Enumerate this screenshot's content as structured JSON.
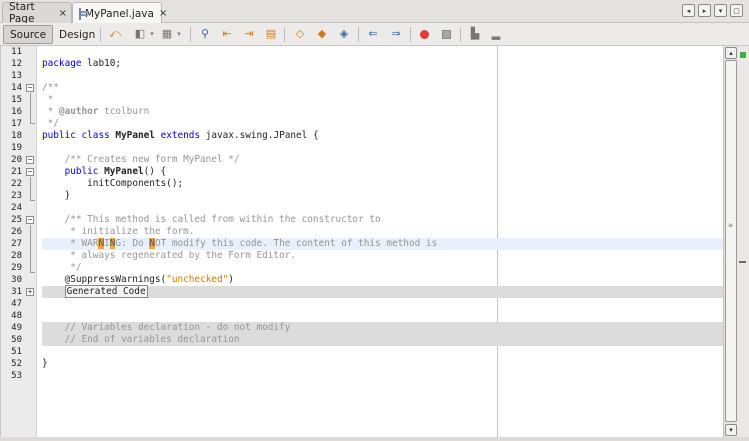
{
  "tabs": [
    {
      "label": "Start Page",
      "active": false
    },
    {
      "label": "MyPanel.java",
      "active": true
    }
  ],
  "tab_close_glyph": "×",
  "window_controls": [
    "◂",
    "▸",
    "▾",
    "▢"
  ],
  "toolbar": {
    "source_label": "Source",
    "design_label": "Design",
    "source_pressed": true
  },
  "gutter": {
    "line_numbers": [
      "11",
      "12",
      "13",
      "14",
      "15",
      "16",
      "17",
      "18",
      "19",
      "20",
      "21",
      "22",
      "23",
      "24",
      "25",
      "26",
      "27",
      "28",
      "29",
      "30",
      "31",
      "47",
      "48",
      "49",
      "50",
      "51",
      "52",
      "53"
    ]
  },
  "code": {
    "l11": "",
    "l12_kw": "package",
    "l12_rest": " lab10;",
    "l13": "",
    "l14": "/**",
    "l15": " *",
    "l16_pre": " * ",
    "l16_tag": "@author",
    "l16_rest": " tcolburn",
    "l17": " */",
    "l18_kw": "public class",
    "l18_cls": "MyPanel",
    "l18_kw2": "extends",
    "l18_rest": " javax.swing.JPanel {",
    "l20": "    /** Creates new form MyPanel */",
    "l21_kw": "public",
    "l21_name": "MyPanel",
    "l21_rest": "() {",
    "l22_a": "        initCo",
    "l22_b": "mponents();",
    "l23": "    }",
    "l25": "    /** This method is called from within the constructor to",
    "l26": "     * initialize the form.",
    "l27_a": "     * WAR",
    "l27_m1": "N",
    "l27_b": "I",
    "l27_m2": "N",
    "l27_c": "G: Do ",
    "l27_m3": "N",
    "l27_d": "OT modify this code. The content of this method is",
    "l28": "     * always regenerated by the Form Editor.",
    "l29": "     */",
    "l30_ann": "    @SuppressWarnings(",
    "l30_str": "\"unchecked\"",
    "l30_rest": ")",
    "l31": "Generated Code",
    "l49": "    // Variables declaration - do not modify",
    "l50": "    // End of variables declaration",
    "l52": "}"
  },
  "scrollbar": {
    "up": "▴",
    "down": "▾",
    "grip": "≡"
  }
}
